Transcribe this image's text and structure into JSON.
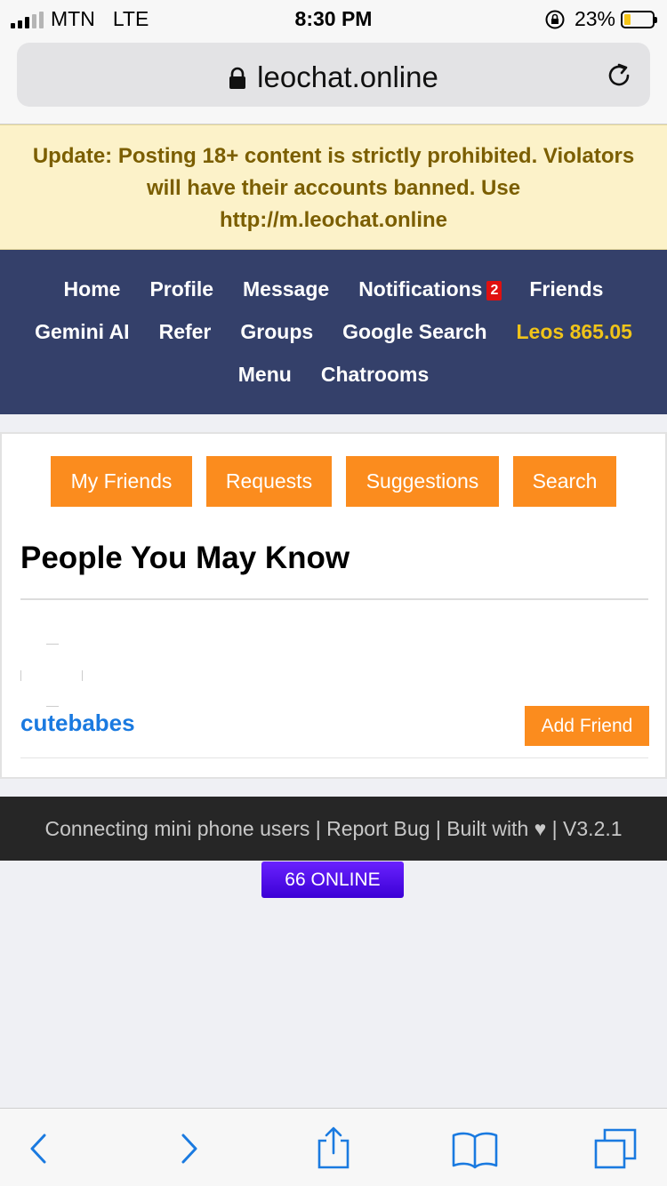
{
  "status_bar": {
    "carrier": "MTN",
    "network": "LTE",
    "time": "8:30 PM",
    "battery_percent": "23%",
    "battery_level": 0.23
  },
  "browser": {
    "url": "leochat.online"
  },
  "notice": {
    "text": "Update: Posting 18+ content is strictly prohibited. Violators will have their accounts banned. Use http://m.leochat.online"
  },
  "nav": {
    "home": "Home",
    "profile": "Profile",
    "message": "Message",
    "notifications": "Notifications",
    "notifications_count": "2",
    "friends": "Friends",
    "gemini": "Gemini AI",
    "refer": "Refer",
    "groups": "Groups",
    "google_search": "Google Search",
    "leos": "Leos 865.05",
    "menu": "Menu",
    "chatrooms": "Chatrooms"
  },
  "tabs": {
    "my_friends": "My Friends",
    "requests": "Requests",
    "suggestions": "Suggestions",
    "search": "Search"
  },
  "section": {
    "title": "People You May Know",
    "suggestion": {
      "username": "cutebabes",
      "action": "Add Friend"
    }
  },
  "footer": {
    "text": "Connecting mini phone users | Report Bug | Built with ♥ | V3.2.1",
    "online": "66 ONLINE"
  },
  "colors": {
    "accent_orange": "#fb8c1e",
    "nav_bg": "#34406a",
    "link_blue": "#1a7ae0",
    "online_purple": "#4a0fe8"
  }
}
